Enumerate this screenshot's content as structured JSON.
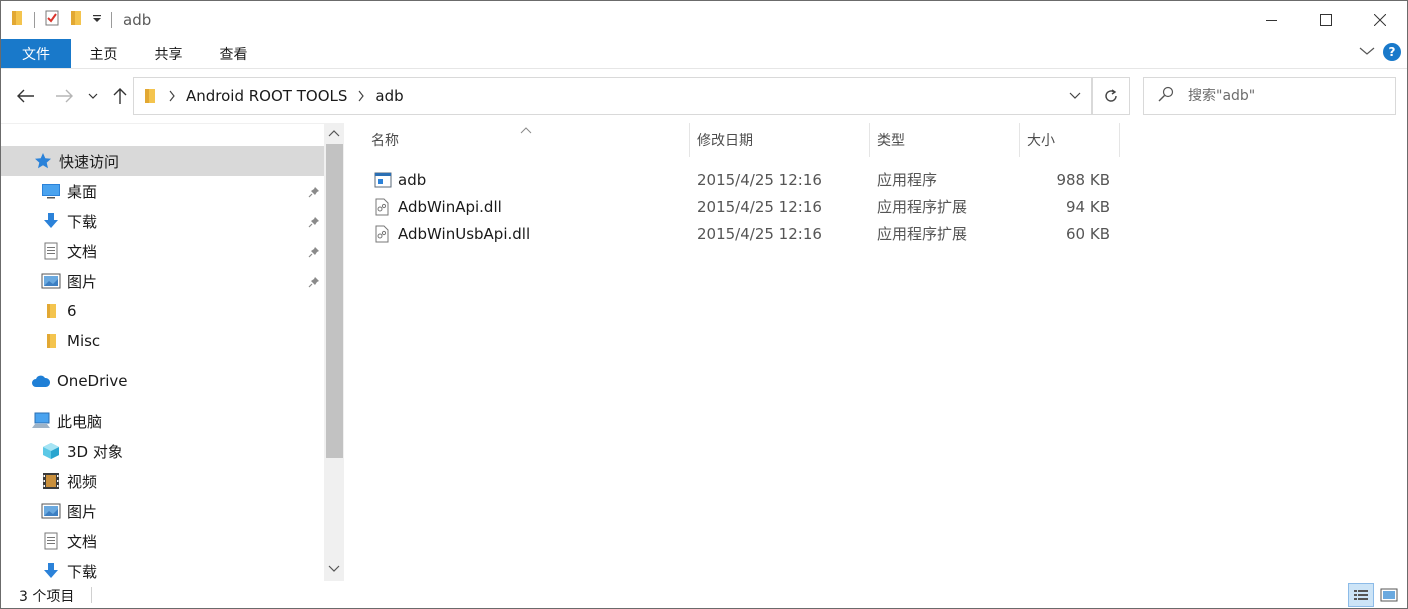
{
  "window": {
    "title": "adb",
    "controls": {
      "minimize": "minimize",
      "maximize": "maximize",
      "close": "close"
    }
  },
  "ribbon": {
    "tabs": [
      "文件",
      "主页",
      "共享",
      "查看"
    ]
  },
  "address": {
    "crumbs": [
      "Android ROOT TOOLS",
      "adb"
    ]
  },
  "search": {
    "placeholder": "搜索\"adb\""
  },
  "nav": {
    "quick_access": "快速访问",
    "items": [
      {
        "label": "桌面",
        "icon": "desktop-icon",
        "pinned": true
      },
      {
        "label": "下载",
        "icon": "download-icon",
        "pinned": true
      },
      {
        "label": "文档",
        "icon": "documents-icon",
        "pinned": true
      },
      {
        "label": "图片",
        "icon": "pictures-icon",
        "pinned": true
      },
      {
        "label": "6",
        "icon": "folder-icon",
        "pinned": false
      },
      {
        "label": "Misc",
        "icon": "folder-icon",
        "pinned": false
      }
    ],
    "onedrive": "OneDrive",
    "this_pc": "此电脑",
    "pc_items": [
      {
        "label": "3D 对象",
        "icon": "3d-objects-icon"
      },
      {
        "label": "视频",
        "icon": "videos-icon"
      },
      {
        "label": "图片",
        "icon": "pictures-icon"
      },
      {
        "label": "文档",
        "icon": "documents-icon"
      },
      {
        "label": "下载",
        "icon": "download-icon"
      }
    ]
  },
  "list": {
    "columns": {
      "name": "名称",
      "modified": "修改日期",
      "type": "类型",
      "size": "大小"
    },
    "files": [
      {
        "name": "adb",
        "modified": "2015/4/25 12:16",
        "type": "应用程序",
        "size": "988 KB",
        "icon": "exe-icon"
      },
      {
        "name": "AdbWinApi.dll",
        "modified": "2015/4/25 12:16",
        "type": "应用程序扩展",
        "size": "94 KB",
        "icon": "dll-icon"
      },
      {
        "name": "AdbWinUsbApi.dll",
        "modified": "2015/4/25 12:16",
        "type": "应用程序扩展",
        "size": "60 KB",
        "icon": "dll-icon"
      }
    ]
  },
  "status": {
    "count": "3 个项目"
  },
  "colors": {
    "accent": "#1979ca",
    "selected_bg": "#d9d9d9",
    "folder": "#f4c44e"
  }
}
